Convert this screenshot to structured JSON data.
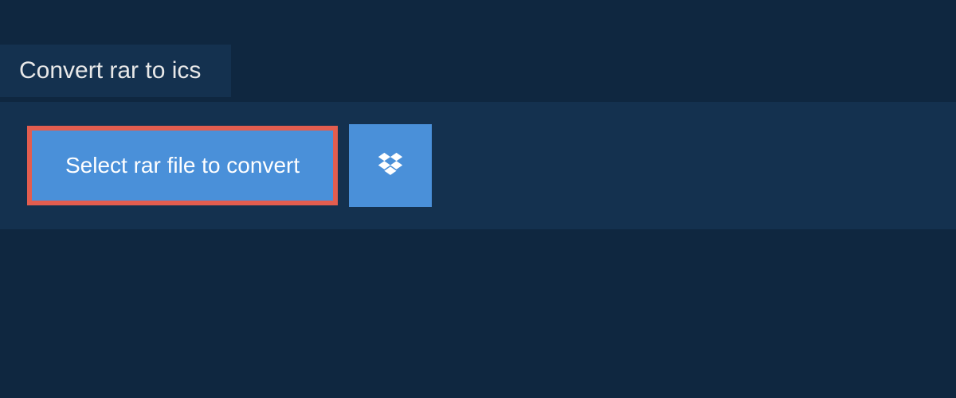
{
  "tab": {
    "title": "Convert rar to ics"
  },
  "panel": {
    "select_button_label": "Select rar file to convert",
    "dropbox_icon_name": "dropbox-icon"
  },
  "colors": {
    "page_background": "#0f2740",
    "panel_background": "#14314f",
    "button_background": "#4a90d9",
    "highlight_border": "#e35d4f",
    "text_light": "#e8e8e8",
    "text_white": "#ffffff"
  }
}
